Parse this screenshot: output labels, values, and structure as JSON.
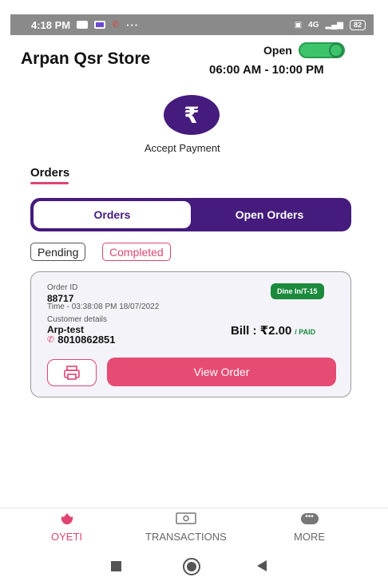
{
  "status_bar": {
    "time": "4:18 PM",
    "dots": "···",
    "network": "4G",
    "battery": "82"
  },
  "header": {
    "store_name": "Arpan Qsr Store",
    "open_label": "Open",
    "hours": "06:00 AM - 10:00 PM",
    "open_toggle": true
  },
  "accept_payment": {
    "icon": "rupee-icon",
    "label": "Accept Payment"
  },
  "section": {
    "title": "Orders"
  },
  "tabs": [
    {
      "label": "Orders",
      "active": true
    },
    {
      "label": "Open Orders",
      "active": false
    }
  ],
  "filters": [
    {
      "label": "Pending",
      "active": false
    },
    {
      "label": "Completed",
      "active": true
    }
  ],
  "order": {
    "id_label": "Order ID",
    "id": "88717",
    "time": "Time - 03:38:08 PM 18/07/2022",
    "badge": "Dine In/T-15",
    "customer_label": "Customer details",
    "customer_name": "Arp-test",
    "phone": "8010862851",
    "bill": "Bill : ₹2.00",
    "paid": "/ PAID",
    "view_button": "View Order"
  },
  "bottom_nav": [
    {
      "label": "OYETI",
      "icon": "lotus-icon",
      "active": true
    },
    {
      "label": "TRANSACTIONS",
      "icon": "cash-icon",
      "active": false
    },
    {
      "label": "MORE",
      "icon": "more-dots-icon",
      "active": false
    }
  ],
  "colors": {
    "primary": "#451b7d",
    "accent": "#e04571",
    "success": "#1b8a3c",
    "toggle": "#3cc46a"
  }
}
